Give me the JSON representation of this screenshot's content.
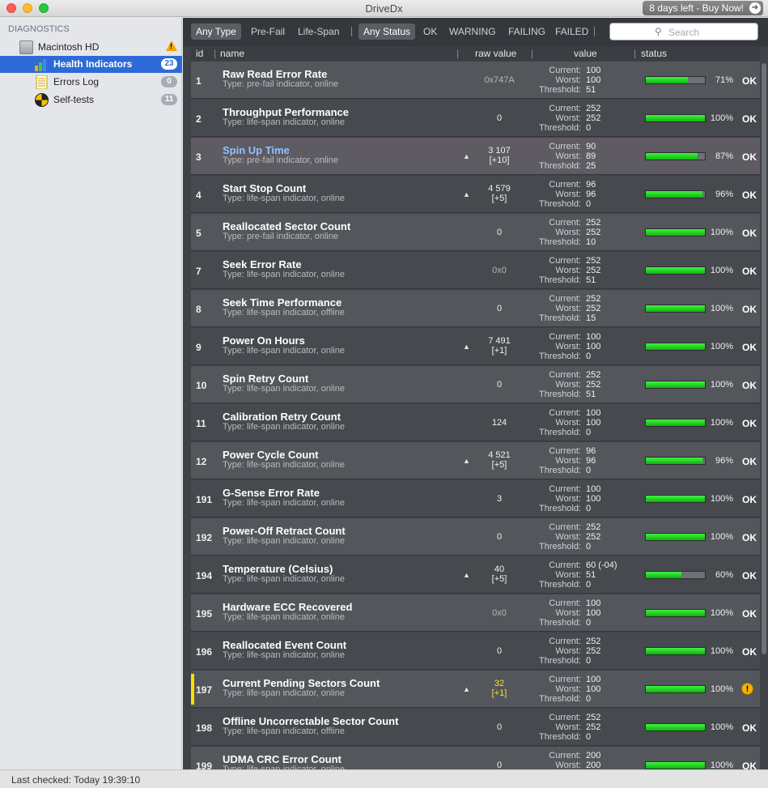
{
  "window": {
    "title": "DriveDx",
    "buy_button": "8 days left - Buy Now!"
  },
  "sidebar": {
    "header": "DIAGNOSTICS",
    "drive": {
      "label": "Macintosh HD",
      "warning_icon": "warning-icon"
    },
    "items": [
      {
        "label": "Health Indicators",
        "badge": "23",
        "icon": "bar-chart-icon"
      },
      {
        "label": "Errors Log",
        "badge": "0",
        "icon": "document-icon"
      },
      {
        "label": "Self-tests",
        "badge": "11",
        "icon": "test-circle-icon"
      }
    ]
  },
  "filters": {
    "type": [
      "Any Type",
      "Pre-Fail",
      "Life-Span"
    ],
    "status": [
      "Any Status",
      "OK",
      "WARNING",
      "FAILING",
      "FAILED"
    ],
    "search_placeholder": "Search"
  },
  "columns": {
    "id": "id",
    "name": "name",
    "raw": "raw value",
    "value": "value",
    "status": "status"
  },
  "value_labels": {
    "current": "Current:",
    "worst": "Worst:",
    "threshold": "Threshold:"
  },
  "rows": [
    {
      "id": "1",
      "name": "Raw Read Error Rate",
      "type": "Type: pre-fail indicator, online",
      "raw": "0x747A",
      "raw2": "",
      "trend": false,
      "current": "100",
      "worst": "100",
      "threshold": "51",
      "pct": "71%",
      "fill": 0.71,
      "status": "OK"
    },
    {
      "id": "2",
      "name": "Throughput Performance",
      "type": "Type: life-span indicator, online",
      "raw": "0",
      "raw2": "",
      "trend": false,
      "current": "252",
      "worst": "252",
      "threshold": "0",
      "pct": "100%",
      "fill": 1.0,
      "status": "OK"
    },
    {
      "id": "3",
      "name": "Spin Up Time",
      "type": "Type: pre-fail indicator, online",
      "raw": "3 107",
      "raw2": "[+10]",
      "trend": true,
      "current": "90",
      "worst": "89",
      "threshold": "25",
      "pct": "87%",
      "fill": 0.87,
      "status": "OK"
    },
    {
      "id": "4",
      "name": "Start Stop Count",
      "type": "Type: life-span indicator, online",
      "raw": "4 579",
      "raw2": "[+5]",
      "trend": true,
      "current": "96",
      "worst": "96",
      "threshold": "0",
      "pct": "96%",
      "fill": 0.96,
      "status": "OK"
    },
    {
      "id": "5",
      "name": "Reallocated Sector Count",
      "type": "Type: pre-fail indicator, online",
      "raw": "0",
      "raw2": "",
      "trend": false,
      "current": "252",
      "worst": "252",
      "threshold": "10",
      "pct": "100%",
      "fill": 1.0,
      "status": "OK"
    },
    {
      "id": "7",
      "name": "Seek Error Rate",
      "type": "Type: life-span indicator, online",
      "raw": "0x0",
      "raw2": "",
      "trend": false,
      "current": "252",
      "worst": "252",
      "threshold": "51",
      "pct": "100%",
      "fill": 1.0,
      "status": "OK"
    },
    {
      "id": "8",
      "name": "Seek Time Performance",
      "type": "Type: life-span indicator, offline",
      "raw": "0",
      "raw2": "",
      "trend": false,
      "current": "252",
      "worst": "252",
      "threshold": "15",
      "pct": "100%",
      "fill": 1.0,
      "status": "OK"
    },
    {
      "id": "9",
      "name": "Power On Hours",
      "type": "Type: life-span indicator, online",
      "raw": "7 491",
      "raw2": "[+1]",
      "trend": true,
      "current": "100",
      "worst": "100",
      "threshold": "0",
      "pct": "100%",
      "fill": 1.0,
      "status": "OK"
    },
    {
      "id": "10",
      "name": "Spin Retry Count",
      "type": "Type: life-span indicator, online",
      "raw": "0",
      "raw2": "",
      "trend": false,
      "current": "252",
      "worst": "252",
      "threshold": "51",
      "pct": "100%",
      "fill": 1.0,
      "status": "OK"
    },
    {
      "id": "11",
      "name": "Calibration Retry Count",
      "type": "Type: life-span indicator, online",
      "raw": "124",
      "raw2": "",
      "trend": false,
      "current": "100",
      "worst": "100",
      "threshold": "0",
      "pct": "100%",
      "fill": 1.0,
      "status": "OK"
    },
    {
      "id": "12",
      "name": "Power Cycle Count",
      "type": "Type: life-span indicator, online",
      "raw": "4 521",
      "raw2": "[+5]",
      "trend": true,
      "current": "96",
      "worst": "96",
      "threshold": "0",
      "pct": "96%",
      "fill": 0.96,
      "status": "OK"
    },
    {
      "id": "191",
      "name": "G-Sense Error Rate",
      "type": "Type: life-span indicator, online",
      "raw": "3",
      "raw2": "",
      "trend": false,
      "current": "100",
      "worst": "100",
      "threshold": "0",
      "pct": "100%",
      "fill": 1.0,
      "status": "OK"
    },
    {
      "id": "192",
      "name": "Power-Off Retract Count",
      "type": "Type: life-span indicator, online",
      "raw": "0",
      "raw2": "",
      "trend": false,
      "current": "252",
      "worst": "252",
      "threshold": "0",
      "pct": "100%",
      "fill": 1.0,
      "status": "OK"
    },
    {
      "id": "194",
      "name": "Temperature (Celsius)",
      "type": "Type: life-span indicator, online",
      "raw": "40",
      "raw2": "[+5]",
      "trend": true,
      "current": "60  (-04)",
      "worst": "51",
      "threshold": "0",
      "pct": "60%",
      "fill": 0.6,
      "status": "OK"
    },
    {
      "id": "195",
      "name": "Hardware ECC Recovered",
      "type": "Type: life-span indicator, online",
      "raw": "0x0",
      "raw2": "",
      "trend": false,
      "current": "100",
      "worst": "100",
      "threshold": "0",
      "pct": "100%",
      "fill": 1.0,
      "status": "OK"
    },
    {
      "id": "196",
      "name": "Reallocated Event Count",
      "type": "Type: life-span indicator, online",
      "raw": "0",
      "raw2": "",
      "trend": false,
      "current": "252",
      "worst": "252",
      "threshold": "0",
      "pct": "100%",
      "fill": 1.0,
      "status": "OK"
    },
    {
      "id": "197",
      "name": "Current Pending Sectors Count",
      "type": "Type: life-span indicator, online",
      "raw": "32",
      "raw2": "[+1]",
      "trend": true,
      "current": "100",
      "worst": "100",
      "threshold": "0",
      "pct": "100%",
      "fill": 1.0,
      "status": "!",
      "warning": true
    },
    {
      "id": "198",
      "name": "Offline Uncorrectable Sector Count",
      "type": "Type: life-span indicator, offline",
      "raw": "0",
      "raw2": "",
      "trend": false,
      "current": "252",
      "worst": "252",
      "threshold": "0",
      "pct": "100%",
      "fill": 1.0,
      "status": "OK"
    },
    {
      "id": "199",
      "name": "UDMA CRC Error Count",
      "type": "Type: life-span indicator, online",
      "raw": "0",
      "raw2": "",
      "trend": false,
      "current": "200",
      "worst": "200",
      "threshold": "0",
      "pct": "100%",
      "fill": 1.0,
      "status": "OK"
    }
  ],
  "statusbar": {
    "text": "Last checked: Today 19:39:10"
  }
}
